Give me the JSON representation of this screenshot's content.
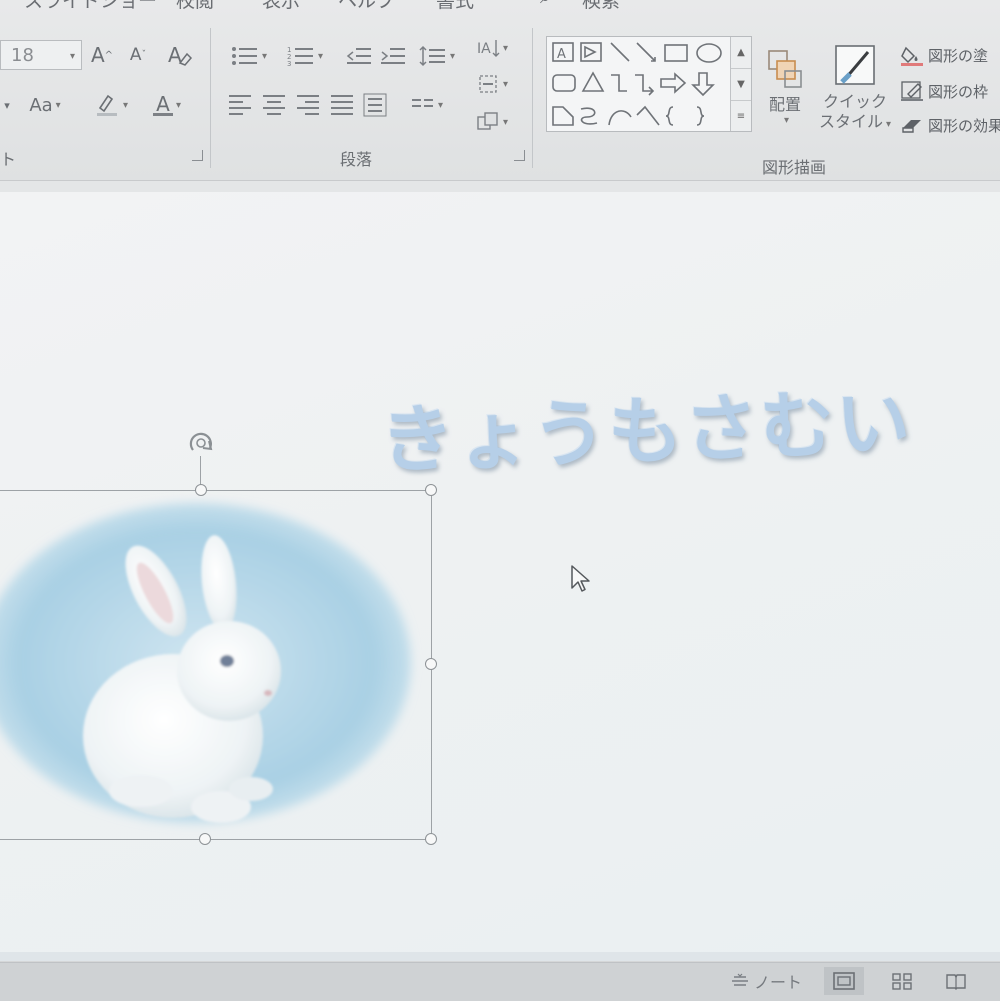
{
  "tabs": {
    "slideshow": "スライドショー",
    "review": "校閲",
    "view": "表示",
    "help": "ヘルプ",
    "format": "書式",
    "search": "検索"
  },
  "ribbon": {
    "font": {
      "size_value": "18",
      "group_label": "ト",
      "increase_label": "A",
      "decrease_label": "A",
      "case_label": "Aa",
      "font_color_label": "A"
    },
    "paragraph": {
      "group_label": "段落"
    },
    "drawing": {
      "group_label": "図形描画",
      "arrange_label": "配置",
      "quick_style_label_1": "クイック",
      "quick_style_label_2": "スタイル",
      "shape_fill_label": "図形の塗",
      "shape_outline_label": "図形の枠",
      "shape_effects_label": "図形の効果"
    }
  },
  "slide": {
    "title": "きょうもさむい"
  },
  "statusbar": {
    "notes_label": "ノート"
  },
  "colors": {
    "title": "#b6cfe8",
    "picture_oval": "#a9d0e4",
    "ribbon": "#e4e6e7"
  }
}
